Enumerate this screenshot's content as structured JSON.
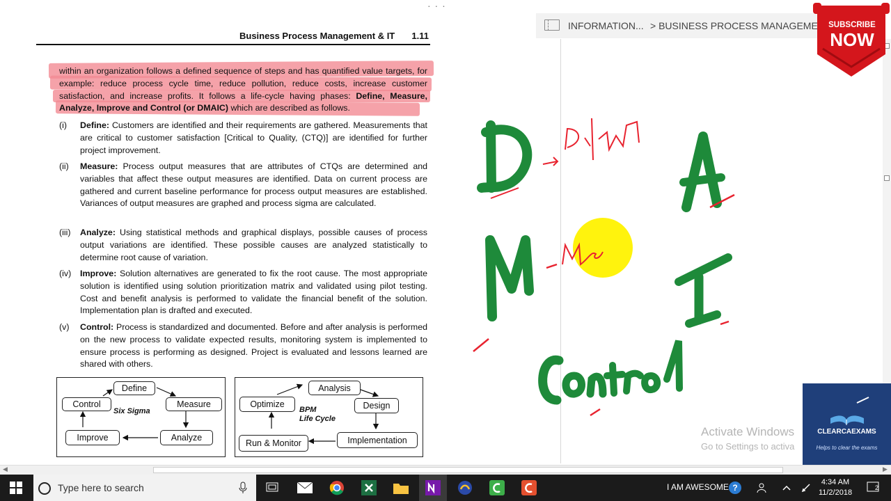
{
  "document": {
    "header_title": "Business Process Management & IT",
    "page_number": "1.11",
    "intro_parts": [
      "within an organization follows a defined sequence of steps and has quantified value targets, for example: reduce process cycle time, reduce pollution, reduce costs, increase customer satisfaction, and increase profits. It follows a life-cycle having phases: ",
      "Define, Measure, Analyze, Improve and Control (or DMAIC)",
      " which are described as follows."
    ],
    "items": [
      {
        "num": "(i)",
        "term": "Define:",
        "text": " Customers are identified and their requirements are gathered. Measurements that are critical to customer satisfaction [Critical to Quality, (CTQ)] are identified for further project improvement."
      },
      {
        "num": "(ii)",
        "term": "Measure:",
        "text": " Process output measures that are attributes of CTQs are determined and variables that affect these output measures are identified. Data on current process are gathered and current baseline performance for process output measures are established. Variances of output measures are graphed and process sigma are calculated."
      },
      {
        "num": "(iii)",
        "term": "Analyze:",
        "text": " Using statistical methods and graphical displays, possible causes of process output variations are identified. These possible causes are analyzed statistically to determine root cause of variation."
      },
      {
        "num": "(iv)",
        "term": "Improve:",
        "text": " Solution alternatives are generated to fix the root cause. The most appropriate solution is identified using solution prioritization matrix and validated using pilot testing. Cost and benefit analysis is performed to validate the financial benefit of the solution. Implementation plan is drafted and executed."
      },
      {
        "num": "(v)",
        "term": "Control:",
        "text": " Process is standardized and documented. Before and after analysis is performed on the new process to validate expected results, monitoring system is implemented to ensure process is performing as designed. Project is evaluated and lessons learned are shared with others."
      }
    ],
    "six_sigma": {
      "label": "Six Sigma",
      "define": "Define",
      "measure": "Measure",
      "analyze": "Analyze",
      "improve": "Improve",
      "control": "Control"
    },
    "bpm": {
      "label_line1": "BPM",
      "label_line2": "Life Cycle",
      "analysis": "Analysis",
      "design": "Design",
      "implementation": "Implementation",
      "run_monitor": "Run & Monitor",
      "optimize": "Optimize"
    }
  },
  "notes": {
    "breadcrumb_section": "INFORMATION...",
    "breadcrumb_page": "> BUSINESS PROCESS MANAGEMENT IT",
    "ink_colors": {
      "green": "#1e8a3a",
      "red": "#e8232f",
      "highlighter": "#fff200"
    }
  },
  "overlays": {
    "subscribe_line1": "SUBSCRIBE",
    "subscribe_line2": "NOW",
    "logo_title": "CLEARCAEXAMS",
    "logo_tagline": "Helps to clear the exams",
    "activate_line1": "Activate Windows",
    "activate_line2": "Go to Settings to activa"
  },
  "taskbar": {
    "search_placeholder": "Type here to search",
    "user_label": "I AM AWESOME",
    "time": "4:34 AM",
    "date": "11/2/2018",
    "notification_count": "2"
  }
}
